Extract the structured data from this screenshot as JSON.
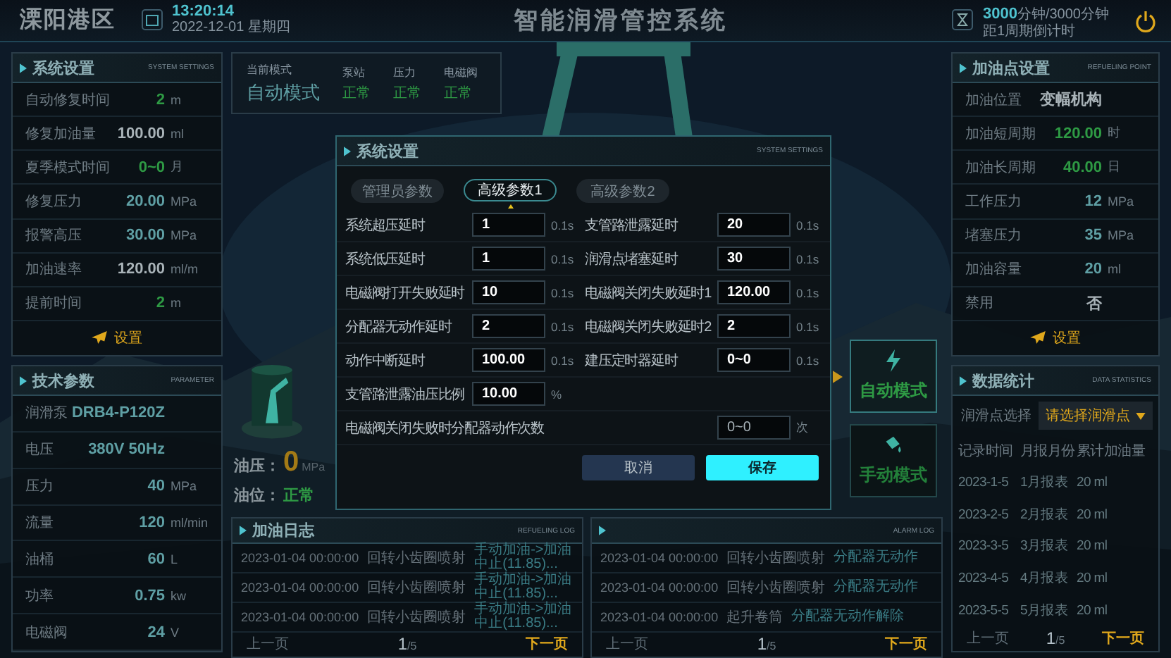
{
  "header": {
    "region": "溧阳港区",
    "time": "13:20:14",
    "date": "2022-12-01 星期四",
    "title": "智能润滑管控系统",
    "countdown_value": "3000",
    "countdown_unit": "分钟",
    "countdown_total": "/3000分钟",
    "countdown_label": "距1周期倒计时"
  },
  "system_settings": {
    "title": "系统设置",
    "subtitle": "SYSTEM SETTINGS",
    "rows": [
      {
        "label": "自动修复时间",
        "value": "2",
        "unit": "m",
        "color": "#2e9a44"
      },
      {
        "label": "修复加油量",
        "value": "100.00",
        "unit": "ml",
        "color": "#a9b3b8"
      },
      {
        "label": "夏季模式时间",
        "value": "0~0",
        "unit": "月",
        "color": "#2e9a44"
      },
      {
        "label": "修复压力",
        "value": "20.00",
        "unit": "MPa",
        "color": "#5f9fa4"
      },
      {
        "label": "报警高压",
        "value": "30.00",
        "unit": "MPa",
        "color": "#5f9fa4"
      },
      {
        "label": "加油速率",
        "value": "120.00",
        "unit": "ml/m",
        "color": "#a9b3b8"
      },
      {
        "label": "提前时间",
        "value": "2",
        "unit": "m",
        "color": "#2e9a44"
      }
    ],
    "button": "设置"
  },
  "technical_parameters": {
    "title": "技术参数",
    "subtitle": "PARAMETER",
    "rows": [
      {
        "label": "润滑泵",
        "value": "DRB4-P120Z"
      },
      {
        "label": "电压",
        "value": "380V 50Hz"
      },
      {
        "label": "压力",
        "value": "40",
        "unit": "MPa"
      },
      {
        "label": "流量",
        "value": "120",
        "unit": "ml/min"
      },
      {
        "label": "油桶",
        "value": "60",
        "unit": "L"
      },
      {
        "label": "功率",
        "value": "0.75",
        "unit": "kw"
      },
      {
        "label": "电磁阀",
        "value": "24",
        "unit": "V"
      }
    ]
  },
  "status": {
    "mode_label": "当前模式",
    "mode": "自动模式",
    "items": [
      {
        "label": "泵站",
        "value": "正常"
      },
      {
        "label": "压力",
        "value": "正常"
      },
      {
        "label": "电磁阀",
        "value": "正常"
      }
    ]
  },
  "gauges": {
    "oil_pressure_label": "油压：",
    "oil_pressure": "0",
    "oil_pressure_unit": "MPa",
    "oil_level_label": "油位：",
    "oil_level": "正常"
  },
  "mode_buttons": [
    {
      "label": "自动模式",
      "kind": "auto",
      "selected": true
    },
    {
      "label": "手动模式",
      "kind": "manual",
      "selected": false
    }
  ],
  "refuel_log": {
    "title": "加油日志",
    "subtitle": "REFUELING LOG",
    "rows": [
      [
        "2023-01-04 00:00:00",
        "回转小齿圈喷射",
        "手动加油->加油中止(11.85)..."
      ],
      [
        "2023-01-04 00:00:00",
        "回转小齿圈喷射",
        "手动加油->加油中止(11.85)..."
      ],
      [
        "2023-01-04 00:00:00",
        "回转小齿圈喷射",
        "手动加油->加油中止(11.85)..."
      ]
    ],
    "pager": {
      "prev": "上一页",
      "page": "1",
      "total": "/5",
      "next": "下一页"
    }
  },
  "alarm_log": {
    "subtitle": "ALARM LOG",
    "rows": [
      [
        "2023-01-04 00:00:00",
        "回转小齿圈喷射",
        "分配器无动作"
      ],
      [
        "2023-01-04 00:00:00",
        "回转小齿圈喷射",
        "分配器无动作"
      ],
      [
        "2023-01-04 00:00:00",
        "起升卷筒",
        "分配器无动作解除"
      ]
    ],
    "pager": {
      "prev": "上一页",
      "page": "1",
      "total": "/5",
      "next": "下一页"
    }
  },
  "refuel_point": {
    "title": "加油点设置",
    "subtitle": "REFUELING POINT",
    "rows": [
      {
        "label": "加油位置",
        "value": "变幅机构",
        "color": "#a9b3b8"
      },
      {
        "label": "加油短周期",
        "value": "120.00",
        "unit": "时",
        "color": "#2e9a44"
      },
      {
        "label": "加油长周期",
        "value": "40.00",
        "unit": "日",
        "color": "#2e9a44"
      },
      {
        "label": "工作压力",
        "value": "12",
        "unit": "MPa",
        "color": "#5f9fa4"
      },
      {
        "label": "堵塞压力",
        "value": "35",
        "unit": "MPa",
        "color": "#5f9fa4"
      },
      {
        "label": "加油容量",
        "value": "20",
        "unit": "ml",
        "color": "#5f9fa4"
      },
      {
        "label": "禁用",
        "value": "否",
        "color": "#a9b3b8"
      }
    ],
    "button": "设置"
  },
  "statistics": {
    "title": "数据统计",
    "subtitle": "DATA STATISTICS",
    "select_label": "润滑点选择",
    "select_placeholder": "请选择润滑点",
    "columns": [
      "记录时间",
      "月报月份",
      "累计加油量"
    ],
    "rows": [
      [
        "2023-1-5",
        "1月报表",
        "20 ml"
      ],
      [
        "2023-2-5",
        "2月报表",
        "20 ml"
      ],
      [
        "2023-3-5",
        "3月报表",
        "20 ml"
      ],
      [
        "2023-4-5",
        "4月报表",
        "20 ml"
      ],
      [
        "2023-5-5",
        "5月报表",
        "20 ml"
      ]
    ],
    "pager": {
      "prev": "上一页",
      "page": "1",
      "total": "/5",
      "next": "下一页"
    }
  },
  "dialog": {
    "title": "系统设置",
    "subtitle": "SYSTEM SETTINGS",
    "tabs": [
      {
        "label": "管理员参数",
        "selected": false
      },
      {
        "label": "高级参数1",
        "selected": true
      },
      {
        "label": "高级参数2",
        "selected": false
      }
    ],
    "rows": [
      [
        {
          "label": "系统超压延时",
          "value": "1",
          "unit": "0.1s"
        },
        {
          "label": "支管路泄露延时",
          "value": "20",
          "unit": "0.1s"
        }
      ],
      [
        {
          "label": "系统低压延时",
          "value": "1",
          "unit": "0.1s"
        },
        {
          "label": "润滑点堵塞延时",
          "value": "30",
          "unit": "0.1s"
        }
      ],
      [
        {
          "label": "电磁阀打开失败延时",
          "value": "10",
          "unit": "0.1s"
        },
        {
          "label": "电磁阀关闭失败延时1",
          "value": "120.00",
          "unit": "0.1s"
        }
      ],
      [
        {
          "label": "分配器无动作延时",
          "value": "2",
          "unit": "0.1s"
        },
        {
          "label": "电磁阀关闭失败延时2",
          "value": "2",
          "unit": "0.1s"
        }
      ],
      [
        {
          "label": "动作中断延时",
          "value": "100.00",
          "unit": "0.1s"
        },
        {
          "label": "建压定时器延时",
          "value": "0~0",
          "unit": "0.1s"
        }
      ],
      [
        {
          "label": "支管路泄露油压比例",
          "value": "10.00",
          "unit": "%"
        }
      ],
      [
        {
          "label": "电磁阀关闭失败时分配器动作次数",
          "value": "0~0",
          "unit": "次",
          "kind": "wide"
        }
      ]
    ],
    "buttons": [
      {
        "label": "取消",
        "kind": "secondary"
      },
      {
        "label": "保存",
        "kind": "primary"
      }
    ]
  }
}
